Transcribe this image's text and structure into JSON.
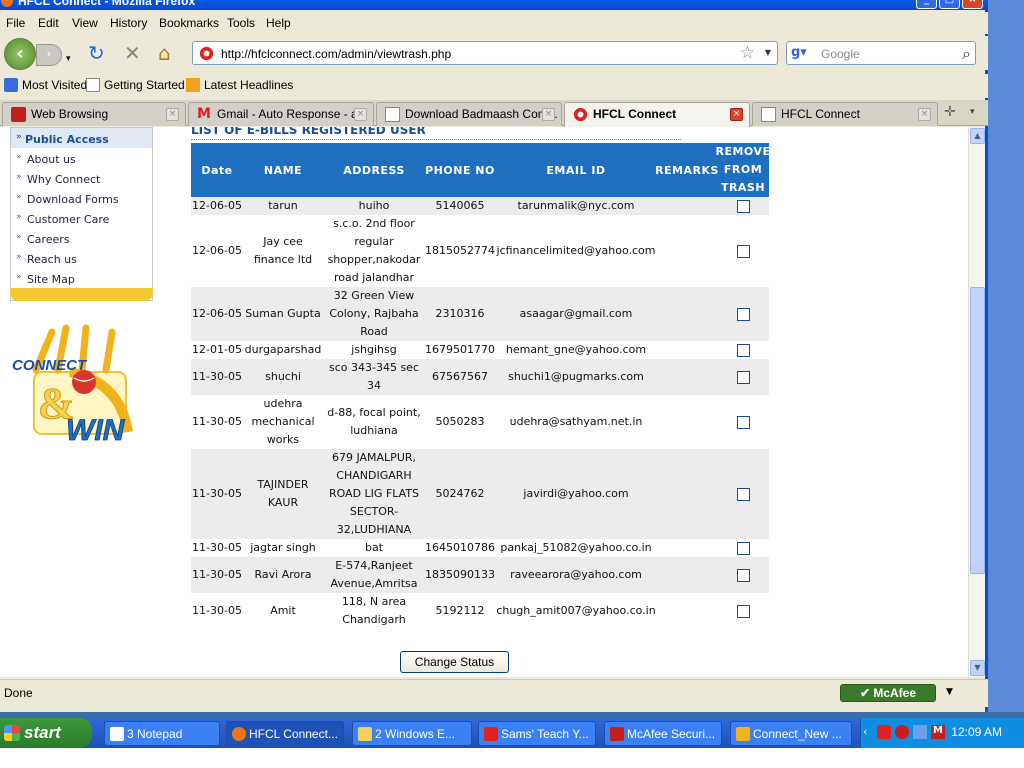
{
  "window": {
    "title": "HFCL Connect - Mozilla Firefox"
  },
  "menu": [
    "File",
    "Edit",
    "View",
    "History",
    "Bookmarks",
    "Tools",
    "Help"
  ],
  "nav": {
    "url": "http://hfclconnect.com/admin/viewtrash.php",
    "search_placeholder": "Google"
  },
  "bookmarks": [
    "Most Visited",
    "Getting Started",
    "Latest Headlines"
  ],
  "tabs": [
    "Web Browsing",
    "Gmail - Auto Response - a...",
    "Download Badmaash Com...",
    "HFCL Connect",
    "HFCL Connect"
  ],
  "sidebar": {
    "header": "Public Access",
    "items": [
      "About us",
      "Why Connect",
      "Download Forms",
      "Customer Care",
      "Careers",
      "Reach us",
      "Site Map"
    ]
  },
  "banner": {
    "line1": "CONNECT",
    "line2": "&",
    "line3": "WIN"
  },
  "table": {
    "title": "LIST OF E-BILLS REGISTERED USER",
    "headers": [
      "Date",
      "NAME",
      "ADDRESS",
      "PHONE NO",
      "EMAIL ID",
      "REMARKS",
      "REMOVE FROM TRASH"
    ],
    "rows": [
      {
        "date": "12-06-05",
        "name": "tarun",
        "address": "huiho",
        "phone": "5140065",
        "email": "tarunmalik@nyc.com"
      },
      {
        "date": "12-06-05",
        "name": "Jay cee finance ltd",
        "address": "s.c.o. 2nd floor regular shopper,nakodar road jalandhar",
        "phone": "1815052774",
        "email": "jcfinancelimited@yahoo.com"
      },
      {
        "date": "12-06-05",
        "name": "Suman Gupta",
        "address": "32 Green View Colony, Rajbaha Road",
        "phone": "2310316",
        "email": "asaagar@gmail.com"
      },
      {
        "date": "12-01-05",
        "name": "durgaparshad",
        "address": "jshgihsg",
        "phone": "1679501770",
        "email": "hemant_gne@yahoo.com"
      },
      {
        "date": "11-30-05",
        "name": "shuchi",
        "address": "sco 343-345 sec 34",
        "phone": "67567567",
        "email": "shuchi1@pugmarks.com"
      },
      {
        "date": "11-30-05",
        "name": "udehra mechanical works",
        "address": "d-88, focal point, ludhiana",
        "phone": "5050283",
        "email": "udehra@sathyam.net.in"
      },
      {
        "date": "11-30-05",
        "name": "TAJINDER KAUR",
        "address": "679 JAMALPUR, CHANDIGARH ROAD LIG FLATS SECTOR-32,LUDHIANA",
        "phone": "5024762",
        "email": "javirdi@yahoo.com"
      },
      {
        "date": "11-30-05",
        "name": "jagtar singh",
        "address": "bat",
        "phone": "1645010786",
        "email": "pankaj_51082@yahoo.co.in"
      },
      {
        "date": "11-30-05",
        "name": "Ravi Arora",
        "address": "E-574,Ranjeet Avenue,Amritsa",
        "phone": "1835090133",
        "email": "raveearora@yahoo.com"
      },
      {
        "date": "11-30-05",
        "name": "Amit",
        "address": "118, N area Chandigarh",
        "phone": "5192112",
        "email": "chugh_amit007@yahoo.co.in"
      }
    ],
    "button": "Change Status"
  },
  "status": {
    "text": "Done",
    "mcafee": "McAfee"
  },
  "taskbar": {
    "start": "start",
    "tasks": [
      "3 Notepad",
      "HFCL Connect...",
      "2 Windows E...",
      "Sams' Teach Y...",
      "McAfee Securi...",
      "Connect_New ..."
    ],
    "clock": "12:09 AM"
  }
}
